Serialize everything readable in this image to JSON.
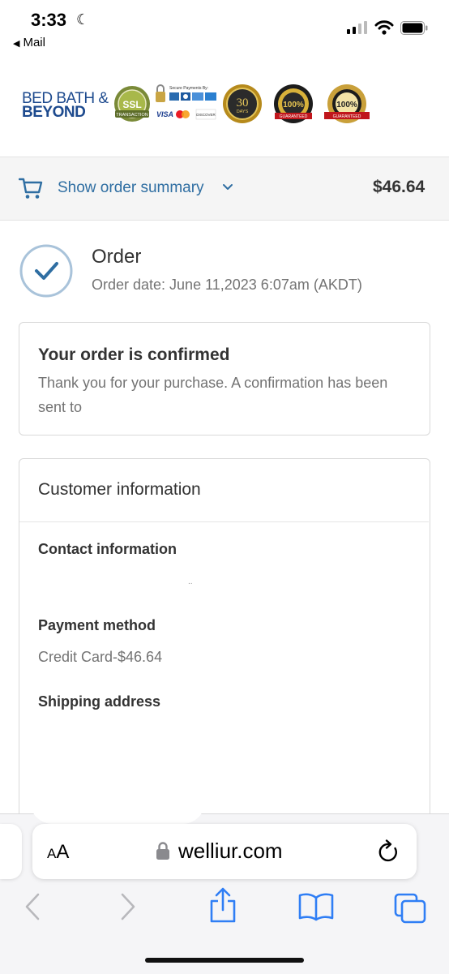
{
  "status_bar": {
    "time": "3:33",
    "back_app": "Mail"
  },
  "brand": {
    "line1": "BED BATH &",
    "line2": "BEYOND"
  },
  "badges": {
    "ssl_text": "SSL",
    "ssl_sub": "TRANSACTION",
    "secure_payments": "Secure Payments By:",
    "visa": "VISA",
    "discover": "DISCOVER",
    "money_back_num": "30",
    "money_back_sub": "DAYS",
    "best_price": "100%",
    "guaranteed": "GUARANTEED",
    "satisfaction": "100%"
  },
  "summary": {
    "label": "Show order summary",
    "total": "$46.64"
  },
  "order": {
    "title": "Order",
    "date": "Order date:  June 11,2023 6:07am (AKDT)"
  },
  "confirm_card": {
    "title": "Your order is confirmed",
    "body": "Thank you for your purchase. A confirmation has been sent to "
  },
  "customer_card": {
    "title": "Customer information",
    "contact_heading": "Contact information",
    "contact_value": "..",
    "payment_heading": "Payment method",
    "payment_value": "Credit Card-$46.64",
    "shipping_heading": "Shipping address"
  },
  "browser": {
    "text_size_label_small": "A",
    "text_size_label_large": "A",
    "url": "welliur.com"
  },
  "colors": {
    "link_blue": "#2f6ea2",
    "ios_blue": "#2f7ef5",
    "brand_navy": "#1d4a8e"
  }
}
